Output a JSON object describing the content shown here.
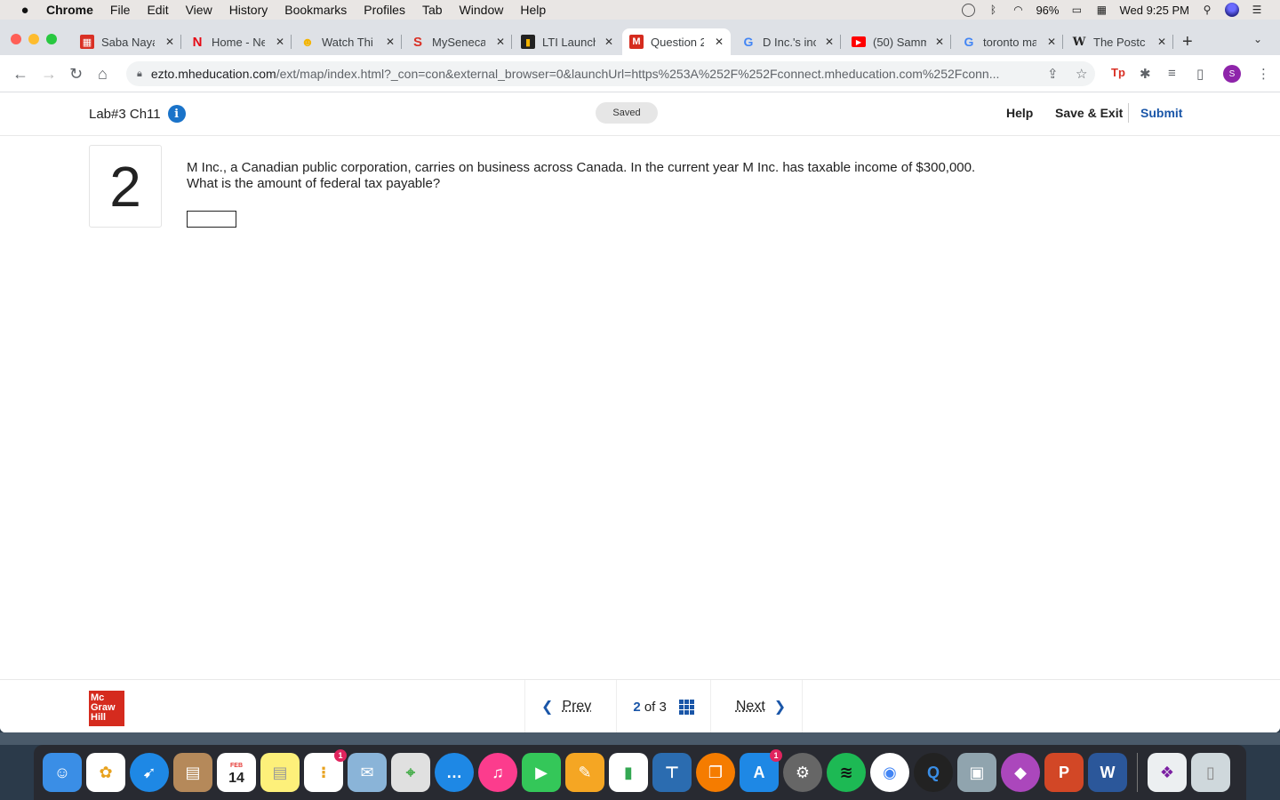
{
  "menubar": {
    "app": "Chrome",
    "menus": [
      "File",
      "Edit",
      "View",
      "History",
      "Bookmarks",
      "Profiles",
      "Tab",
      "Window",
      "Help"
    ],
    "battery": "96%",
    "clock": "Wed 9:25 PM"
  },
  "tabs": [
    {
      "title": "Saba Naya",
      "favicon": "saba-icon",
      "color": "#d93025"
    },
    {
      "title": "Home - Ne",
      "favicon": "netflix-icon",
      "color": "#e50914"
    },
    {
      "title": "Watch Thi",
      "favicon": "watch-icon",
      "color": "#f4b400"
    },
    {
      "title": "MySeneca",
      "favicon": "seneca-icon",
      "color": "#d93025"
    },
    {
      "title": "LTI Launch",
      "favicon": "lti-icon",
      "color": "#333333"
    },
    {
      "title": "Question 2",
      "favicon": "mcgraw-icon",
      "color": "#d52b1e"
    },
    {
      "title": "D Inc.'s inc",
      "favicon": "google-icon",
      "color": "#4285f4"
    },
    {
      "title": "(50) Samm",
      "favicon": "youtube-icon",
      "color": "#ff0000"
    },
    {
      "title": "toronto ma",
      "favicon": "google-icon",
      "color": "#4285f4"
    },
    {
      "title": "The Postc",
      "favicon": "wikipedia-icon",
      "color": "#333333"
    }
  ],
  "address": {
    "domain": "ezto.mheducation.com",
    "path": "/ext/map/index.html?_con=con&external_browser=0&launchUrl=https%253A%252F%252Fconnect.mheducation.com%252Fconn..."
  },
  "header": {
    "title": "Lab#3 Ch11",
    "status": "Saved",
    "help": "Help",
    "save_exit": "Save & Exit",
    "submit": "Submit"
  },
  "question": {
    "number": "2",
    "line1": "M Inc., a Canadian public corporation, carries on business across Canada. In the current year M Inc. has taxable income of $300,000.",
    "line2": "What is the amount of federal tax payable?",
    "answer": ""
  },
  "footer": {
    "logo": [
      "Mc",
      "Graw",
      "Hill"
    ],
    "prev": "Prev",
    "next": "Next",
    "current": "2",
    "of": "of",
    "total": "3"
  },
  "dock": {
    "calendar_day": "14",
    "calendar_month": "FEB"
  },
  "colors": {
    "accent": "#1a56a8",
    "brand": "#d52b1e"
  }
}
